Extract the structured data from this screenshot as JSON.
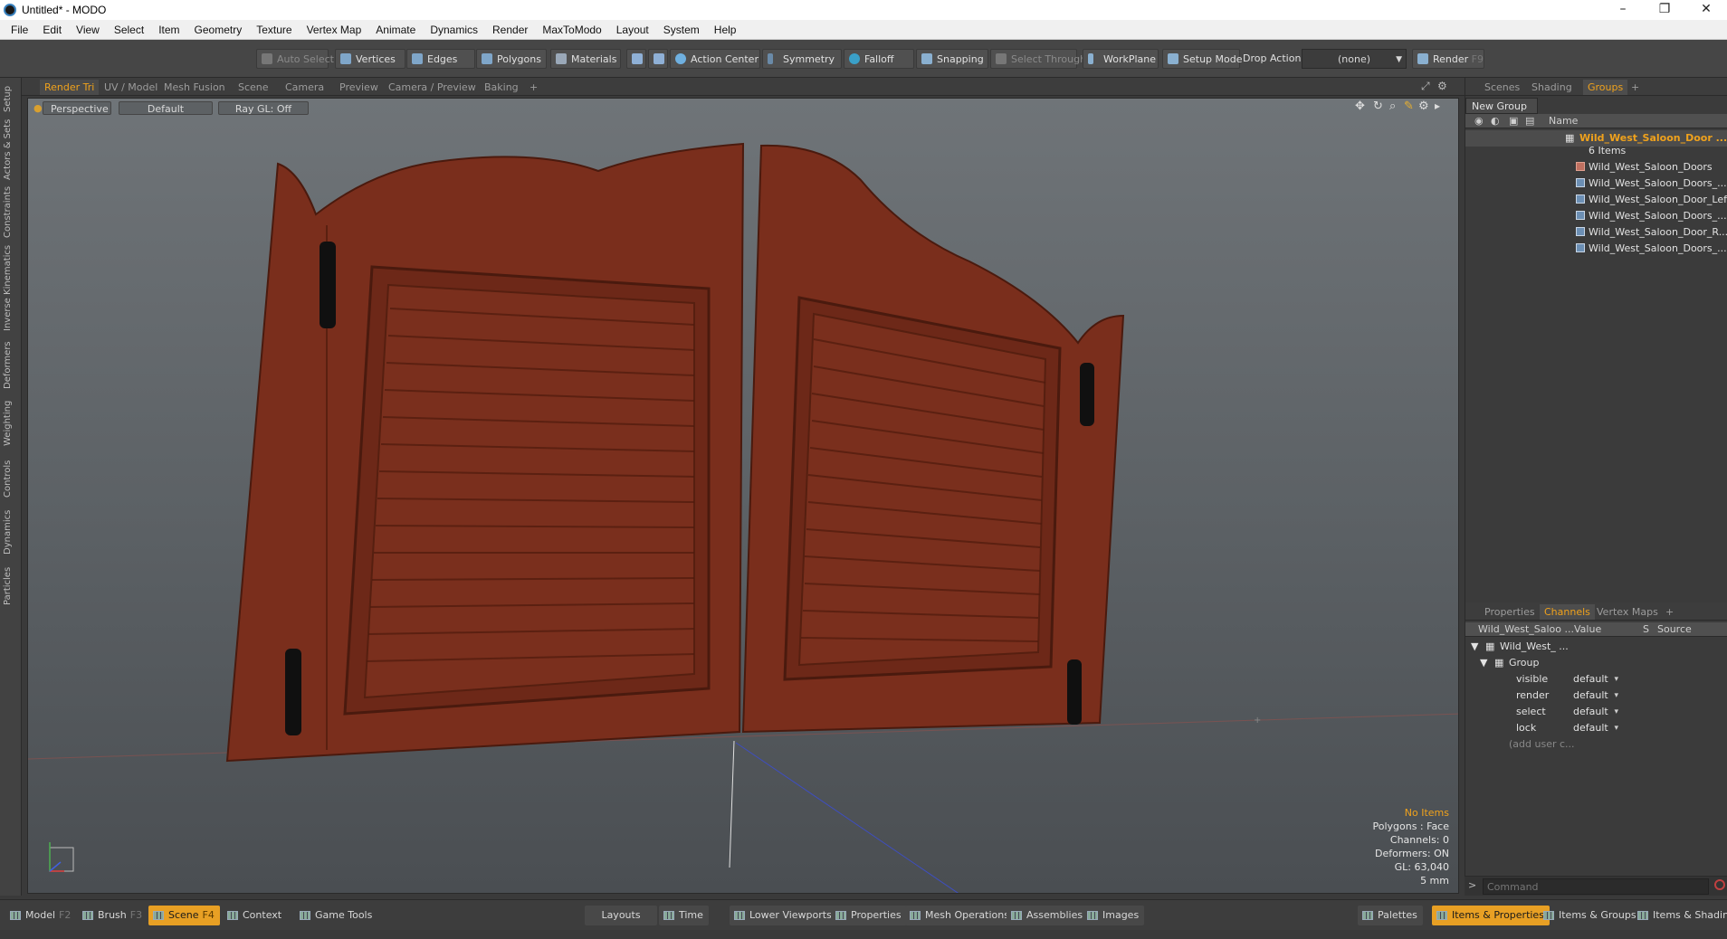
{
  "window": {
    "title": "Untitled* - MODO",
    "minimize": "–",
    "restore": "❐",
    "close": "✕"
  },
  "menu": [
    "File",
    "Edit",
    "View",
    "Select",
    "Item",
    "Geometry",
    "Texture",
    "Vertex Map",
    "Animate",
    "Dynamics",
    "Render",
    "MaxToModo",
    "Layout",
    "System",
    "Help"
  ],
  "toolbar": {
    "auto_select": "Auto Select",
    "vertices": "Vertices",
    "edges": "Edges",
    "polygons": "Polygons",
    "materials": "Materials",
    "action_center": "Action Center",
    "symmetry": "Symmetry",
    "falloff": "Falloff",
    "snapping": "Snapping",
    "select_through": "Select Through",
    "workplane": "WorkPlane",
    "setup_mode": "Setup Mode",
    "drop_action_label": "Drop Action",
    "drop_action_value": "(none)",
    "render": "Render",
    "render_key": "F9"
  },
  "left_tabs": [
    "Setup",
    "Actors & Sets",
    "Constraints",
    "Inverse Kinematics",
    "Deformers",
    "Weighting",
    "Controls",
    "Dynamics",
    "Particles"
  ],
  "viewport_tabs": [
    "Render Tri",
    "UV / Model",
    "Mesh Fusion",
    "Scene",
    "Camera",
    "Preview",
    "Camera / Preview",
    "Baking",
    "+"
  ],
  "viewport": {
    "view": "Perspective",
    "shading": "Default",
    "raygl": "Ray GL: Off",
    "info": {
      "items": "No Items",
      "polygons": "Polygons : Face",
      "channels": "Channels: 0",
      "deformers": "Deformers: ON",
      "gl": "GL: 63,040",
      "unit": "5 mm"
    }
  },
  "scene_panel": {
    "tabs": [
      "Scenes",
      "Shading",
      "Groups",
      "+"
    ],
    "new_group": "New Group",
    "name_header": "Name",
    "group_name": "Wild_West_Saloon_Door ...",
    "group_count": "6 Items",
    "items": [
      "Wild_West_Saloon_Doors",
      "Wild_West_Saloon_Doors_...",
      "Wild_West_Saloon_Door_Left",
      "Wild_West_Saloon_Doors_...",
      "Wild_West_Saloon_Door_R...",
      "Wild_West_Saloon_Doors_..."
    ]
  },
  "channels_panel": {
    "tabs": [
      "Properties",
      "Channels",
      "Vertex Maps",
      "+"
    ],
    "header_name": "Wild_West_Saloo ...",
    "header_value": "Value",
    "header_s": "S",
    "header_source": "Source",
    "root": "Wild_West_ ...",
    "group": "Group",
    "channels": [
      {
        "name": "visible",
        "value": "default"
      },
      {
        "name": "render",
        "value": "default"
      },
      {
        "name": "select",
        "value": "default"
      },
      {
        "name": "lock",
        "value": "default"
      }
    ],
    "add_user": "(add user c..."
  },
  "command": {
    "placeholder": "Command"
  },
  "bottom": {
    "model": "Model",
    "model_key": "F2",
    "brush": "Brush",
    "brush_key": "F3",
    "scene": "Scene",
    "scene_key": "F4",
    "context": "Context",
    "game_tools": "Game Tools",
    "layouts": "Layouts",
    "time": "Time",
    "lower_viewports": "Lower Viewports",
    "properties": "Properties",
    "mesh_operations": "Mesh Operations",
    "assemblies": "Assemblies",
    "images": "Images",
    "palettes": "Palettes",
    "items_properties": "Items & Properties",
    "items_groups": "Items & Groups",
    "items_shading": "Items & Shading"
  }
}
